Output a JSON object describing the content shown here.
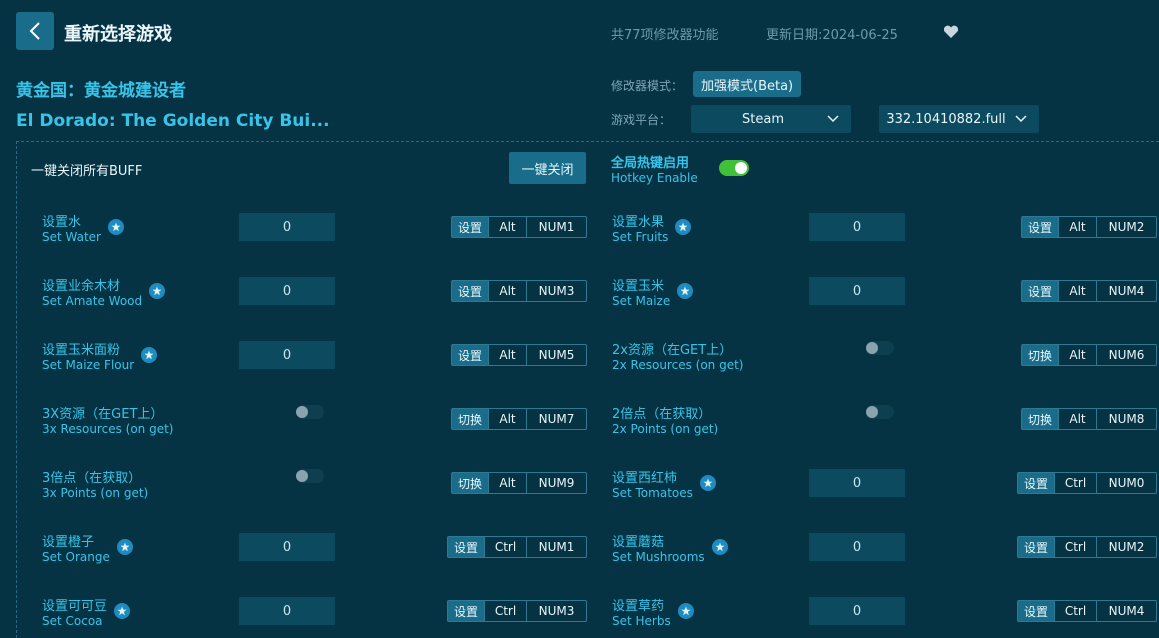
{
  "header": {
    "page_title": "重新选择游戏",
    "feature_count": "共77项修改器功能",
    "update_date": "更新日期:2024-06-25"
  },
  "game": {
    "title_cn": "黄金国：黄金城建设者",
    "title_en": "El Dorado: The Golden City Bui..."
  },
  "meta": {
    "mode_label": "修改器模式：",
    "mode_value": "加强模式(Beta)",
    "platform_label": "游戏平台：",
    "platform_value": "Steam",
    "version_value": "332.10410882.full"
  },
  "controls": {
    "disable_all_label": "一键关闭所有BUFF",
    "disable_all_button": "一键关闭",
    "hotkey_cn": "全局热键启用",
    "hotkey_en": "Hotkey Enable",
    "hotkey_enabled": true
  },
  "cheats": [
    {
      "cn": "设置水",
      "en": "Set Water",
      "star": true,
      "value": "0",
      "action": "设置",
      "mod": "Alt",
      "key": "NUM1"
    },
    {
      "cn": "设置水果",
      "en": "Set Fruits",
      "star": true,
      "value": "0",
      "action": "设置",
      "mod": "Alt",
      "key": "NUM2"
    },
    {
      "cn": "设置业余木材",
      "en": "Set Amate Wood",
      "star": true,
      "value": "0",
      "action": "设置",
      "mod": "Alt",
      "key": "NUM3"
    },
    {
      "cn": "设置玉米",
      "en": "Set Maize",
      "star": true,
      "value": "0",
      "action": "设置",
      "mod": "Alt",
      "key": "NUM4"
    },
    {
      "cn": "设置玉米面粉",
      "en": "Set Maize Flour",
      "star": true,
      "value": "0",
      "action": "设置",
      "mod": "Alt",
      "key": "NUM5"
    },
    {
      "cn": "2x资源（在GET上）",
      "en": "2x Resources (on get)",
      "star": false,
      "toggle": false,
      "action": "切换",
      "mod": "Alt",
      "key": "NUM6"
    },
    {
      "cn": "3X资源（在GET上）",
      "en": "3x Resources (on get)",
      "star": false,
      "toggle": false,
      "action": "切换",
      "mod": "Alt",
      "key": "NUM7"
    },
    {
      "cn": "2倍点（在获取）",
      "en": "2x Points (on get)",
      "star": false,
      "toggle": false,
      "action": "切换",
      "mod": "Alt",
      "key": "NUM8"
    },
    {
      "cn": "3倍点（在获取）",
      "en": "3x Points (on get)",
      "star": false,
      "toggle": false,
      "action": "切换",
      "mod": "Alt",
      "key": "NUM9"
    },
    {
      "cn": "设置西红柿",
      "en": "Set Tomatoes",
      "star": true,
      "value": "0",
      "action": "设置",
      "mod": "Ctrl",
      "key": "NUM0"
    },
    {
      "cn": "设置橙子",
      "en": "Set Orange",
      "star": true,
      "value": "0",
      "action": "设置",
      "mod": "Ctrl",
      "key": "NUM1"
    },
    {
      "cn": "设置蘑菇",
      "en": "Set Mushrooms",
      "star": true,
      "value": "0",
      "action": "设置",
      "mod": "Ctrl",
      "key": "NUM2"
    },
    {
      "cn": "设置可可豆",
      "en": "Set Cocoa",
      "star": true,
      "value": "0",
      "action": "设置",
      "mod": "Ctrl",
      "key": "NUM3"
    },
    {
      "cn": "设置草药",
      "en": "Set Herbs",
      "star": true,
      "value": "0",
      "action": "设置",
      "mod": "Ctrl",
      "key": "NUM4"
    }
  ]
}
